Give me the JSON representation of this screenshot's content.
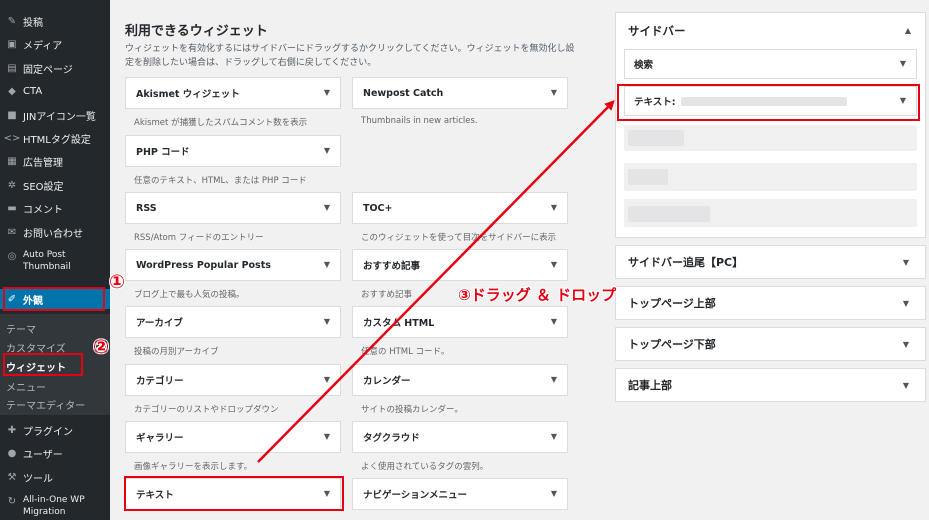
{
  "admin_menu": {
    "top_items": [
      {
        "label": "投稿",
        "icon": "pin-icon"
      },
      {
        "label": "メディア",
        "icon": "media-icon"
      },
      {
        "label": "固定ページ",
        "icon": "page-icon"
      },
      {
        "label": "CTA",
        "icon": "cta-icon"
      },
      {
        "label": "JINアイコン一覧",
        "icon": "list-icon"
      },
      {
        "label": "HTMLタグ設定",
        "icon": "code-icon"
      },
      {
        "label": "広告管理",
        "icon": "ad-icon"
      },
      {
        "label": "SEO設定",
        "icon": "gear-icon"
      },
      {
        "label": "コメント",
        "icon": "comment-icon"
      },
      {
        "label": "お問い合わせ",
        "icon": "mail-icon"
      }
    ],
    "auto_post_line1": "Auto Post",
    "auto_post_line2": "Thumbnail",
    "appearance": "外観",
    "submenu": [
      "テーマ",
      "カスタマイズ",
      "ウィジェット",
      "メニュー",
      "テーマエディター"
    ],
    "bottom_items": [
      {
        "label": "プラグイン",
        "icon": "plugin-icon"
      },
      {
        "label": "ユーザー",
        "icon": "user-icon"
      },
      {
        "label": "ツール",
        "icon": "wrench-icon"
      }
    ],
    "aio_line1": "All-in-One WP",
    "aio_line2": "Migration"
  },
  "available": {
    "title": "利用できるウィジェット",
    "desc": "ウィジェットを有効化するにはサイドバーにドラッグするかクリックしてください。ウィジェットを無効化し設定を削除したい場合は、ドラッグして右側に戻してください。",
    "left": [
      {
        "name": "Akismet ウィジェット",
        "desc": "Akismet が捕獲したスパムコメント数を表示"
      },
      {
        "name": "PHP コード",
        "desc": "任意のテキスト、HTML、または PHP コード"
      },
      {
        "name": "RSS",
        "desc": "RSS/Atom フィードのエントリー"
      },
      {
        "name": "WordPress Popular Posts",
        "desc": "ブログ上で最も人気の投稿。"
      },
      {
        "name": "アーカイブ",
        "desc": "投稿の月別アーカイブ"
      },
      {
        "name": "カテゴリー",
        "desc": "カテゴリーのリストやドロップダウン"
      },
      {
        "name": "ギャラリー",
        "desc": "画像ギャラリーを表示します。"
      },
      {
        "name": "テキスト",
        "desc": ""
      }
    ],
    "right": [
      {
        "name": "Newpost Catch",
        "desc": "Thumbnails in new articles."
      },
      {
        "name": "TOC+",
        "desc": "このウィジェットを使って目次をサイドバーに表示"
      },
      {
        "name": "おすすめ記事",
        "desc": "おすすめ記事"
      },
      {
        "name": "カスタム HTML",
        "desc": "任意の HTML コード。"
      },
      {
        "name": "カレンダー",
        "desc": "サイトの投稿カレンダー。"
      },
      {
        "name": "タグクラウド",
        "desc": "よく使用されているタグの雲列。"
      },
      {
        "name": "ナビゲーションメニュー",
        "desc": ""
      }
    ]
  },
  "sidebar_area": {
    "title": "サイドバー",
    "widgets": [
      "検索",
      "テキスト:"
    ]
  },
  "other_areas": [
    "サイドバー追尾【PC】",
    "トップページ上部",
    "トップページ下部",
    "記事上部"
  ],
  "steps": {
    "one": "①",
    "two": "②",
    "three": "③ドラッグ ＆ ドロップ"
  },
  "colors": {
    "accent": "#e60012",
    "wp_blue": "#0073aa",
    "menu_bg": "#23282d"
  }
}
